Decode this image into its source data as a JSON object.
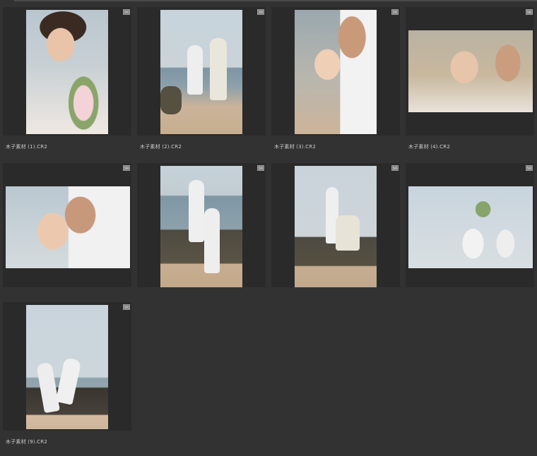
{
  "thumbnails": [
    {
      "filename": "木子素材 (1).CR2",
      "badge": "SR"
    },
    {
      "filename": "木子素材 (2).CR2",
      "badge": "SR"
    },
    {
      "filename": "木子素材 (3).CR2",
      "badge": "SR"
    },
    {
      "filename": "木子素材 (4).CR2",
      "badge": "SR"
    },
    {
      "filename": "",
      "badge": "SR"
    },
    {
      "filename": "",
      "badge": "SR"
    },
    {
      "filename": "",
      "badge": "SR"
    },
    {
      "filename": "",
      "badge": "SR"
    },
    {
      "filename": "木子素材 (9).CR2",
      "badge": "SR"
    }
  ],
  "colors": {
    "background": "#323232",
    "tile": "#2a2a2a",
    "filename_text": "#cfcfcf"
  }
}
